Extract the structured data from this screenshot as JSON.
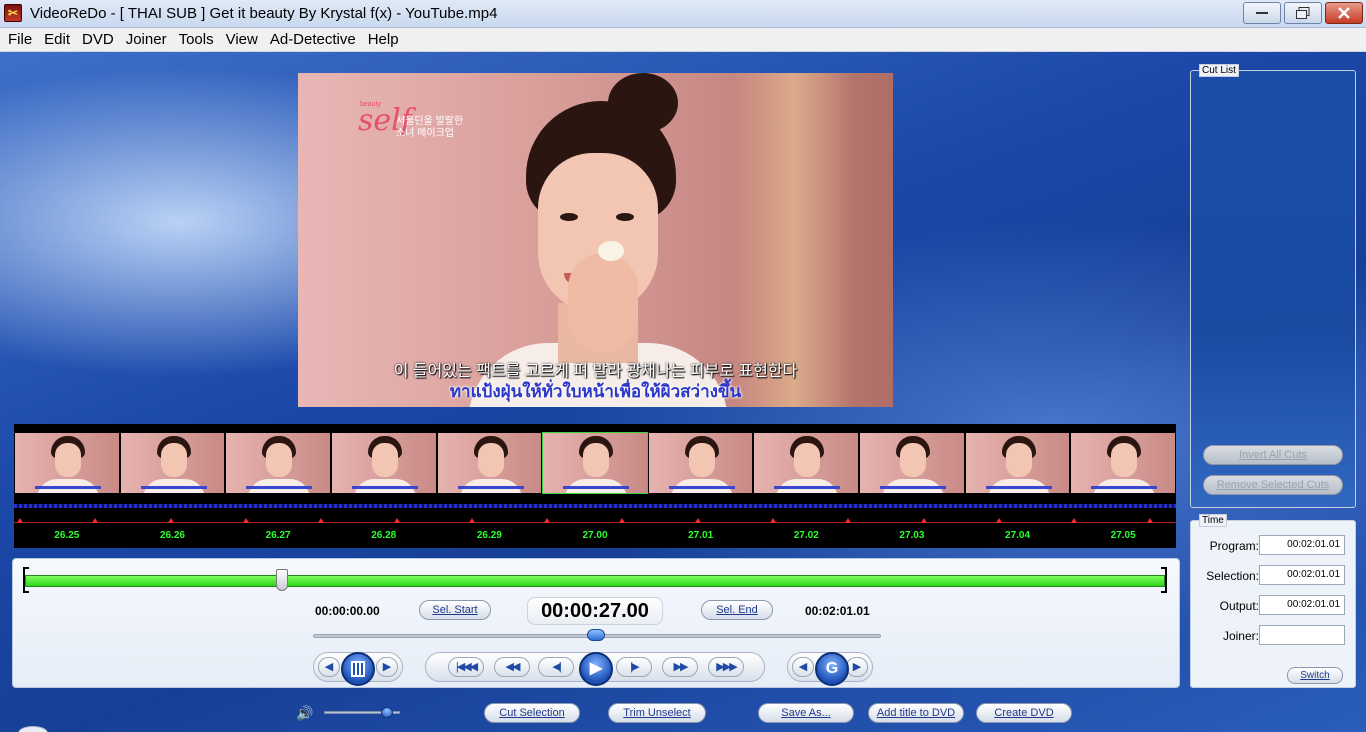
{
  "window": {
    "title": "VideoReDo - [ THAI SUB ] Get it beauty By Krystal f(x) - YouTube.mp4"
  },
  "menu": [
    "File",
    "Edit",
    "DVD",
    "Joiner",
    "Tools",
    "View",
    "Ad-Detective",
    "Help"
  ],
  "video": {
    "logo_main": "self",
    "logo_prefix": "beauty",
    "logo_tag_1": "서울딘올 발랄한",
    "logo_tag_2": "소녀 메이크업",
    "subtitle_korean": "이 들어있는 팩트를 고르게 펴 발라 광채나는 피부로 표현한다",
    "subtitle_thai": "ทาแป้งฝุ่นให้ทั่วใบหน้าเพื่อให้ผิวสว่างขึ้น"
  },
  "timeline": {
    "labels": [
      "26.25",
      "26.26",
      "26.27",
      "26.28",
      "26.29",
      "27.00",
      "27.01",
      "27.02",
      "27.03",
      "27.04",
      "27.05"
    ],
    "active_index": 5
  },
  "controls": {
    "start_time": "00:00:00.00",
    "sel_start": "Sel. Start",
    "current_time": "00:00:27.00",
    "sel_end": "Sel. End",
    "end_time": "00:02:01.01",
    "scrub_position": 0.22,
    "jog_position": 0.5,
    "volume_level": 0.8
  },
  "playback": {
    "btn_home": "|◀◀◀",
    "btn_rew": "◀◀",
    "btn_step_back": "◀|",
    "btn_play": "▶",
    "btn_step_fwd": "|▶",
    "btn_ff": "▶▶",
    "btn_end": "▶▶▶",
    "btn_goto": "G"
  },
  "bottom_buttons": {
    "cut_selection": "Cut Selection",
    "trim_unselect": "Trim Unselect",
    "save_as": "Save As...",
    "add_title": "Add title to DVD",
    "create_dvd": "Create DVD"
  },
  "cut_list": {
    "legend": "Cut List",
    "invert_all": "Invert All Cuts",
    "remove_selected": "Remove Selected Cuts"
  },
  "time_panel": {
    "legend": "Time",
    "program_label": "Program:",
    "program_value": "00:02:01.01",
    "selection_label": "Selection:",
    "selection_value": "00:02:01.01",
    "output_label": "Output:",
    "output_value": "00:02:01.01",
    "joiner_label": "Joiner:",
    "joiner_value": "",
    "switch": "Switch"
  },
  "colors": {
    "timeline_label": "#2cff2c",
    "progress_green": "#2fd51b",
    "accent_blue": "#1f4aa5"
  }
}
